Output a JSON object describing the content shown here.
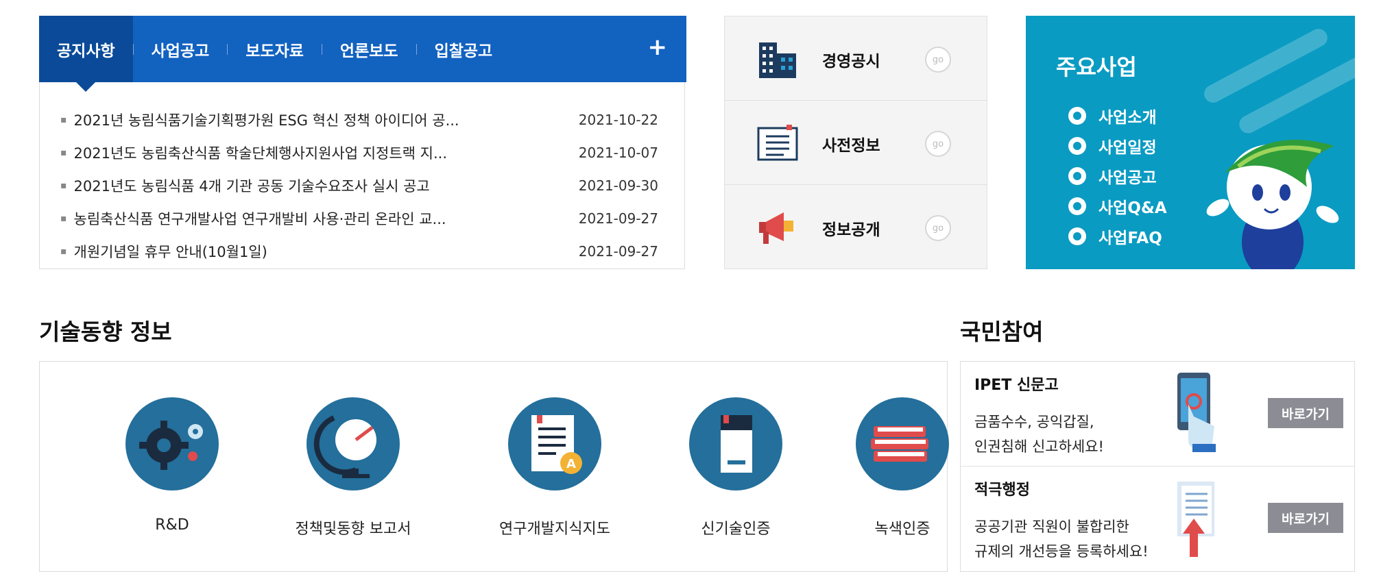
{
  "notice": {
    "tabs": [
      "공지사항",
      "사업공고",
      "보도자료",
      "언론보도",
      "입찰공고"
    ],
    "plus": "+",
    "items": [
      {
        "title": "2021년 농림식품기술기획평가원 ESG 혁신 정책 아이디어 공...",
        "date": "2021-10-22"
      },
      {
        "title": "2021년도 농림축산식품 학술단체행사지원사업 지정트랙 지...",
        "date": "2021-10-07"
      },
      {
        "title": "2021년도 농림식품 4개 기관 공동 기술수요조사 실시 공고",
        "date": "2021-09-30"
      },
      {
        "title": "농림축산식품 연구개발사업 연구개발비 사용·관리 온라인 교...",
        "date": "2021-09-27"
      },
      {
        "title": "개원기념일 휴무 안내(10월1일)",
        "date": "2021-09-27"
      }
    ]
  },
  "quick": {
    "go": "go",
    "items": [
      {
        "label": "경영공시",
        "icon": "building-icon"
      },
      {
        "label": "사전정보",
        "icon": "document-board-icon"
      },
      {
        "label": "정보공개",
        "icon": "megaphone-icon"
      }
    ]
  },
  "biz": {
    "title": "주요사업",
    "items": [
      "사업소개",
      "사업일정",
      "사업공고",
      "사업Q&A",
      "사업FAQ"
    ],
    "background": "#0a9bc2"
  },
  "tech": {
    "title": "기술동향 정보",
    "items": [
      {
        "label": "R&D",
        "icon": "gears-icon"
      },
      {
        "label": "정책및동향 보고서",
        "icon": "globe-icon"
      },
      {
        "label": "연구개발지식지도",
        "icon": "document-a-icon"
      },
      {
        "label": "신기술인증",
        "icon": "book-icon"
      },
      {
        "label": "녹색인증",
        "icon": "books-stack-icon"
      }
    ]
  },
  "participation": {
    "title": "국민참여",
    "items": [
      {
        "title": "IPET 신문고",
        "desc1": "금품수수, 공익갑질,",
        "desc2": "인권침해 신고하세요!",
        "button": "바로가기"
      },
      {
        "title": "적극행정",
        "desc1": "공공기관 직원이 불합리한",
        "desc2": "규제의 개선등을 등록하세요!",
        "button": "바로가기"
      }
    ]
  },
  "colors": {
    "primary_blue": "#1262c0",
    "active_tab": "#0a4a99",
    "icon_circle": "#246f9b",
    "button_gray": "#8c8c95"
  }
}
